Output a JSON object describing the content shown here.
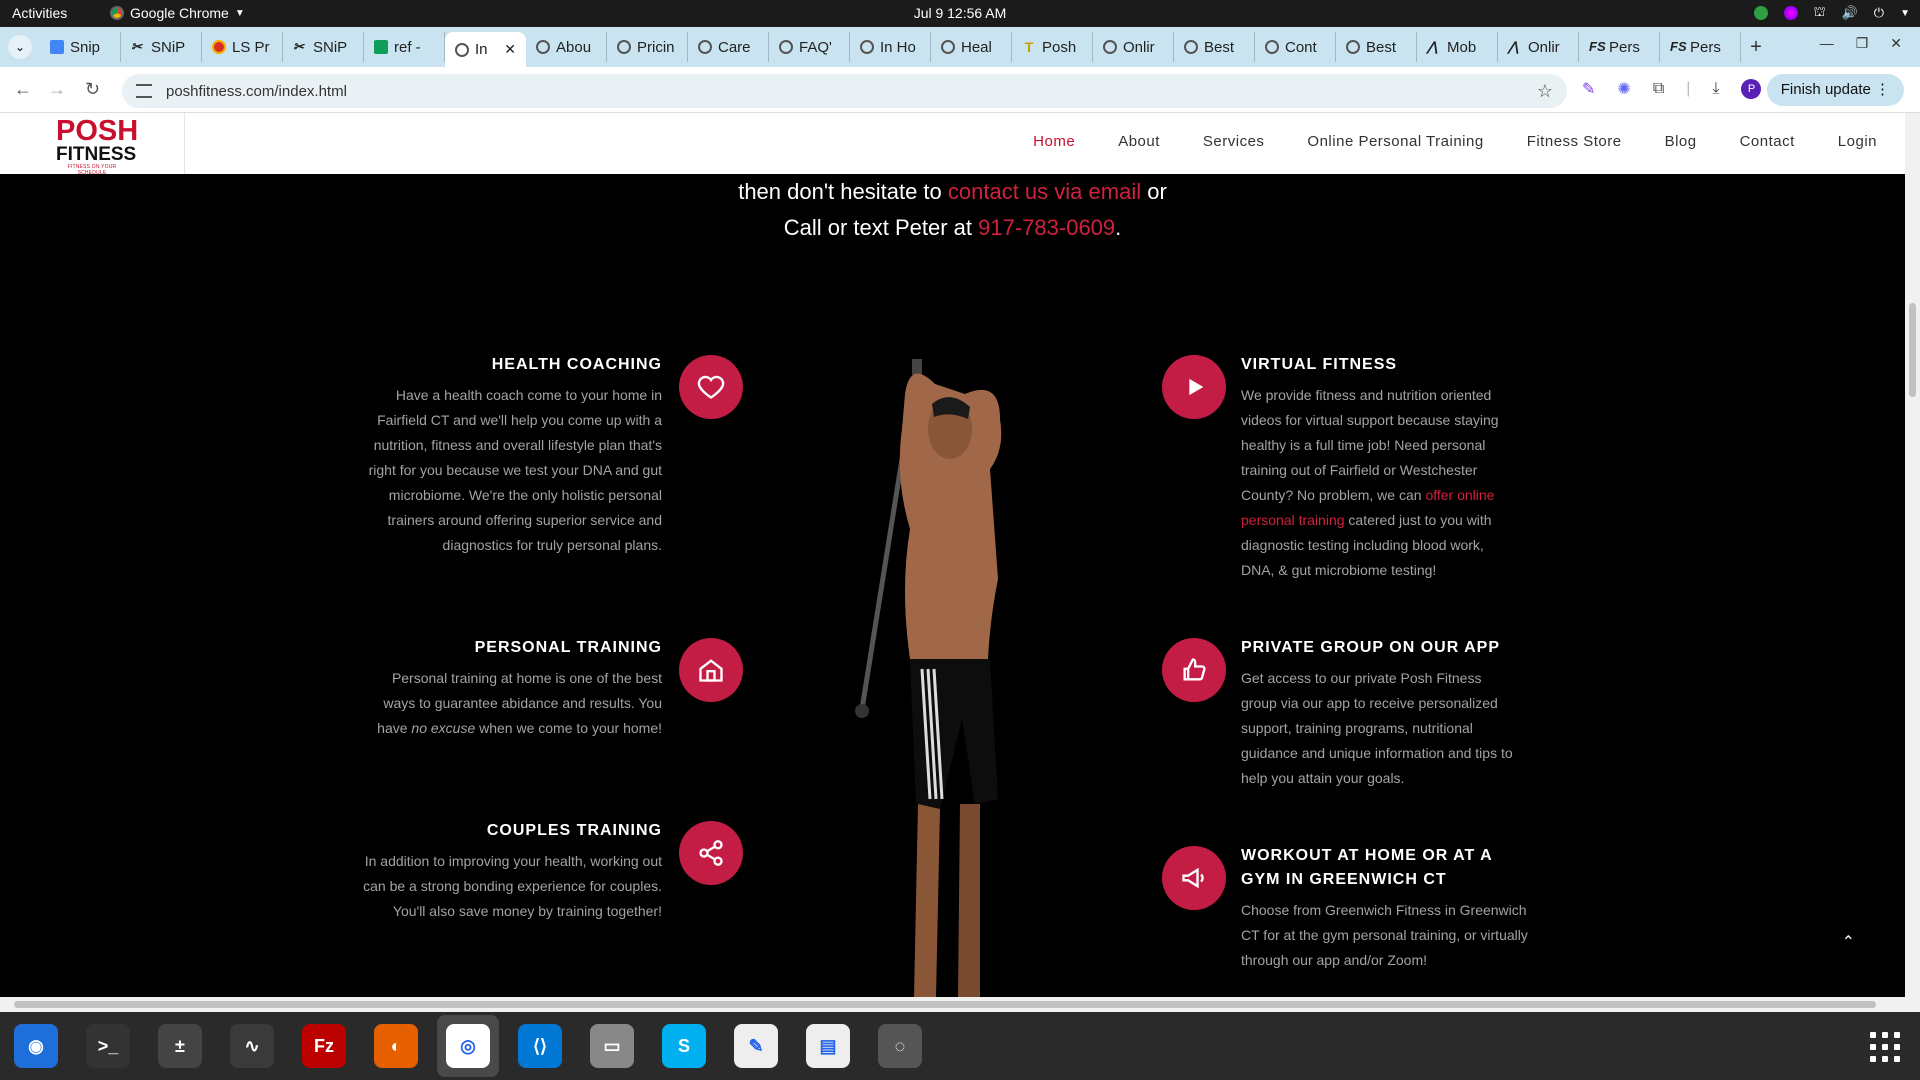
{
  "system": {
    "activities": "Activities",
    "app_name": "Google Chrome",
    "clock": "Jul 9  12:56 AM"
  },
  "browser": {
    "tabs": [
      {
        "label": "Snip",
        "icon": "docs-icon"
      },
      {
        "label": "SNiP",
        "icon": "snip-icon"
      },
      {
        "label": "LS Pr",
        "icon": "ls-icon"
      },
      {
        "label": "SNiP",
        "icon": "snip-icon"
      },
      {
        "label": "ref - ",
        "icon": "sheets-icon"
      },
      {
        "label": "In",
        "icon": "globe-icon",
        "active": true
      },
      {
        "label": "Abou",
        "icon": "globe-icon"
      },
      {
        "label": "Pricin",
        "icon": "globe-icon"
      },
      {
        "label": "Care",
        "icon": "globe-icon"
      },
      {
        "label": "FAQ'",
        "icon": "globe-icon"
      },
      {
        "label": "In Ho",
        "icon": "globe-icon"
      },
      {
        "label": "Heal",
        "icon": "globe-icon"
      },
      {
        "label": "Posh",
        "icon": "posh-icon"
      },
      {
        "label": "Onlir",
        "icon": "globe-icon"
      },
      {
        "label": "Best",
        "icon": "globe-icon"
      },
      {
        "label": "Cont",
        "icon": "globe-icon"
      },
      {
        "label": "Best",
        "icon": "globe-icon"
      },
      {
        "label": "Mob",
        "icon": "mobile-icon"
      },
      {
        "label": "Onlir",
        "icon": "online-icon"
      },
      {
        "label": "Pers",
        "icon": "fs-icon"
      },
      {
        "label": "Pers",
        "icon": "fs-icon"
      }
    ],
    "url": "poshfitness.com/index.html",
    "finish_update": "Finish update",
    "avatar_letter": "P"
  },
  "site": {
    "logo": {
      "line1": "POSH",
      "line2": "FITNESS",
      "tagline": "FITNESS ON YOUR SCHEDULE"
    },
    "nav": [
      {
        "label": "Home",
        "active": true
      },
      {
        "label": "About"
      },
      {
        "label": "Services"
      },
      {
        "label": "Online Personal Training"
      },
      {
        "label": "Fitness Store"
      },
      {
        "label": "Blog"
      },
      {
        "label": "Contact"
      },
      {
        "label": "Login"
      }
    ],
    "contact": {
      "line1_pre": "then don't hesitate to ",
      "line1_link": "contact us via email",
      "line1_post": " or",
      "line2_pre": "Call or text Peter at ",
      "line2_link": "917-783-0609",
      "line2_post": "."
    },
    "services_left": [
      {
        "title": "HEALTH COACHING",
        "icon": "heart-icon",
        "text": "Have a health coach come to your home in Fairfield CT and we'll help you come up with a nutrition, fitness and overall lifestyle plan that's right for you because we test your DNA and gut microbiome. We're the only holistic personal trainers around offering superior service and diagnostics for truly personal plans."
      },
      {
        "title": "PERSONAL TRAINING",
        "icon": "home-icon",
        "text_pre": "Personal training at home is one of the best ways to guarantee abidance and results. You have ",
        "text_em": "no excuse",
        "text_post": " when we come to your home!"
      },
      {
        "title": "COUPLES TRAINING",
        "icon": "share-icon",
        "text": "In addition to improving your health, working out can be a strong bonding experience for couples. You'll also save money by training together!"
      }
    ],
    "services_right": [
      {
        "title": "VIRTUAL FITNESS",
        "icon": "play-icon",
        "text_pre": "We provide fitness and nutrition oriented videos for virtual support because staying healthy is a full time job! Need personal training out of Fairfield or Westchester County? No problem, we can ",
        "text_link": "offer online personal training",
        "text_post": " catered just to you with diagnostic testing including blood work, DNA, & gut microbiome testing!"
      },
      {
        "title": "PRIVATE GROUP ON OUR APP",
        "icon": "thumbs-up-icon",
        "text": "Get access to our private Posh Fitness group via our app to receive personalized support, training programs, nutritional guidance and unique information and tips to help you attain your goals."
      },
      {
        "title": "WORKOUT AT HOME OR AT A GYM IN GREENWICH CT",
        "icon": "megaphone-icon",
        "text": "Choose from Greenwich Fitness in Greenwich CT for at the gym personal training, or virtually through our app and/or Zoom!"
      }
    ],
    "scroll_top": "⌃"
  },
  "dock": [
    "finder-icon",
    "terminal-icon",
    "calculator-icon",
    "system-monitor-icon",
    "filezilla-icon",
    "firefox-icon",
    "chrome-icon",
    "vscode-icon",
    "files-icon",
    "skype-icon",
    "text-editor-icon",
    "document-viewer-icon",
    "disk-icon"
  ]
}
